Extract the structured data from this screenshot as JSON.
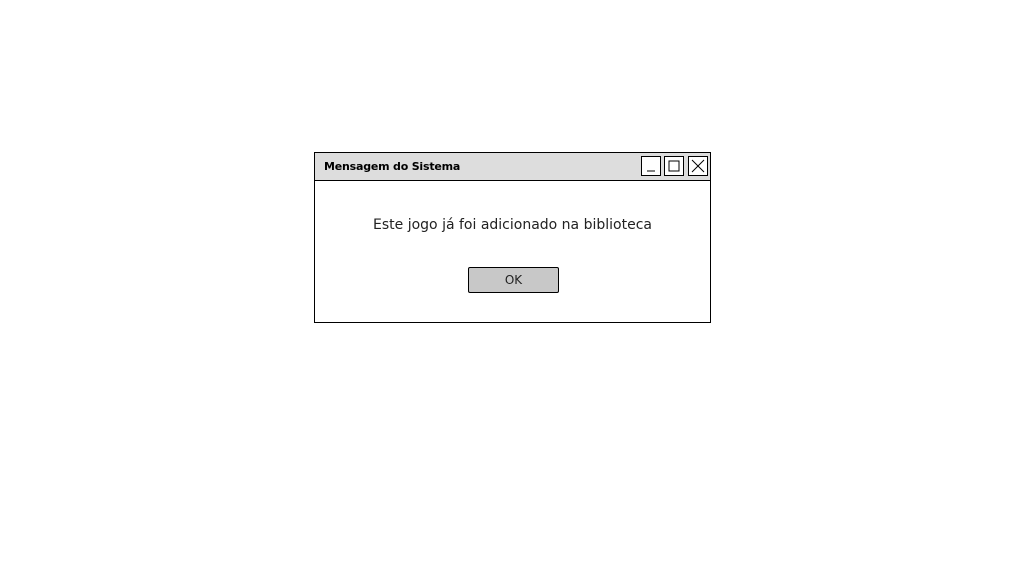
{
  "dialog": {
    "title": "Mensagem do Sistema",
    "message": "Este jogo já foi adicionado na biblioteca",
    "ok_label": "OK"
  },
  "window_controls": {
    "minimize_icon": "minimize-icon",
    "maximize_icon": "maximize-icon",
    "close_icon": "close-icon"
  },
  "colors": {
    "titlebar_bg": "#dddddd",
    "button_bg": "#c8c8c8",
    "border": "#000000"
  }
}
